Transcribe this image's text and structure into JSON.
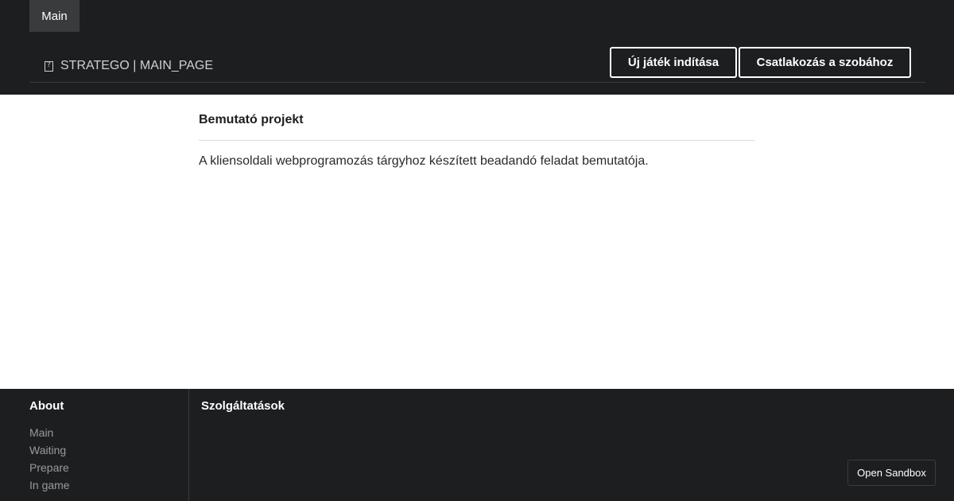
{
  "header": {
    "tab_main": "Main",
    "brand_icon": "missing-glyph-icon",
    "brand_text": "STRATEGO | MAIN_PAGE",
    "new_game_label": "Új játék indítása",
    "join_room_label": "Csatlakozás a szobához"
  },
  "main": {
    "title": "Bemutató projekt",
    "description": "A kliensoldali webprogramozás tárgyhoz készített beadandó feladat bemutatója."
  },
  "footer": {
    "about_heading": "About",
    "about_links": [
      "Main",
      "Waiting",
      "Prepare",
      "In game"
    ],
    "services_heading": "Szolgáltatások"
  },
  "sandbox_label": "Open Sandbox",
  "colors": {
    "header_bg": "#1d1e20",
    "tab_active_bg": "#3a3b3d",
    "text_light": "#ffffff",
    "text_muted": "#9a9a9a"
  }
}
